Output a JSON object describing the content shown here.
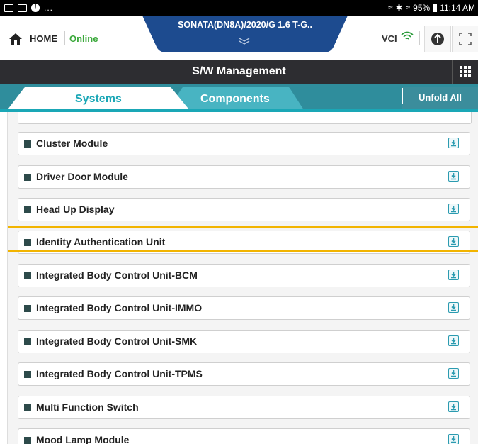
{
  "status_bar": {
    "battery": "95%",
    "time": "11:14 AM",
    "dots": "..."
  },
  "header": {
    "home_label": "HOME",
    "connection_status": "Online",
    "vehicle": "SONATA(DN8A)/2020/G 1.6 T-G..",
    "vci_label": "VCI"
  },
  "title": "S/W Management",
  "tabs": [
    {
      "label": "Systems",
      "active": true
    },
    {
      "label": "Components",
      "active": false
    }
  ],
  "unfold_label": "Unfold All",
  "modules": [
    {
      "label": "Cluster Module"
    },
    {
      "label": "Driver Door Module"
    },
    {
      "label": "Head Up Display"
    },
    {
      "label": "Identity Authentication Unit",
      "highlighted": true
    },
    {
      "label": "Integrated Body Control Unit-BCM"
    },
    {
      "label": "Integrated Body Control Unit-IMMO"
    },
    {
      "label": "Integrated Body Control Unit-SMK"
    },
    {
      "label": "Integrated Body Control Unit-TPMS"
    },
    {
      "label": "Multi Function Switch"
    },
    {
      "label": "Mood Lamp Module"
    }
  ],
  "colors": {
    "accent": "#1aa7b6",
    "header_blue": "#1d4b8f",
    "online_green": "#3aa83a",
    "highlight": "#f2b400",
    "title_bg": "#2d2d31"
  }
}
